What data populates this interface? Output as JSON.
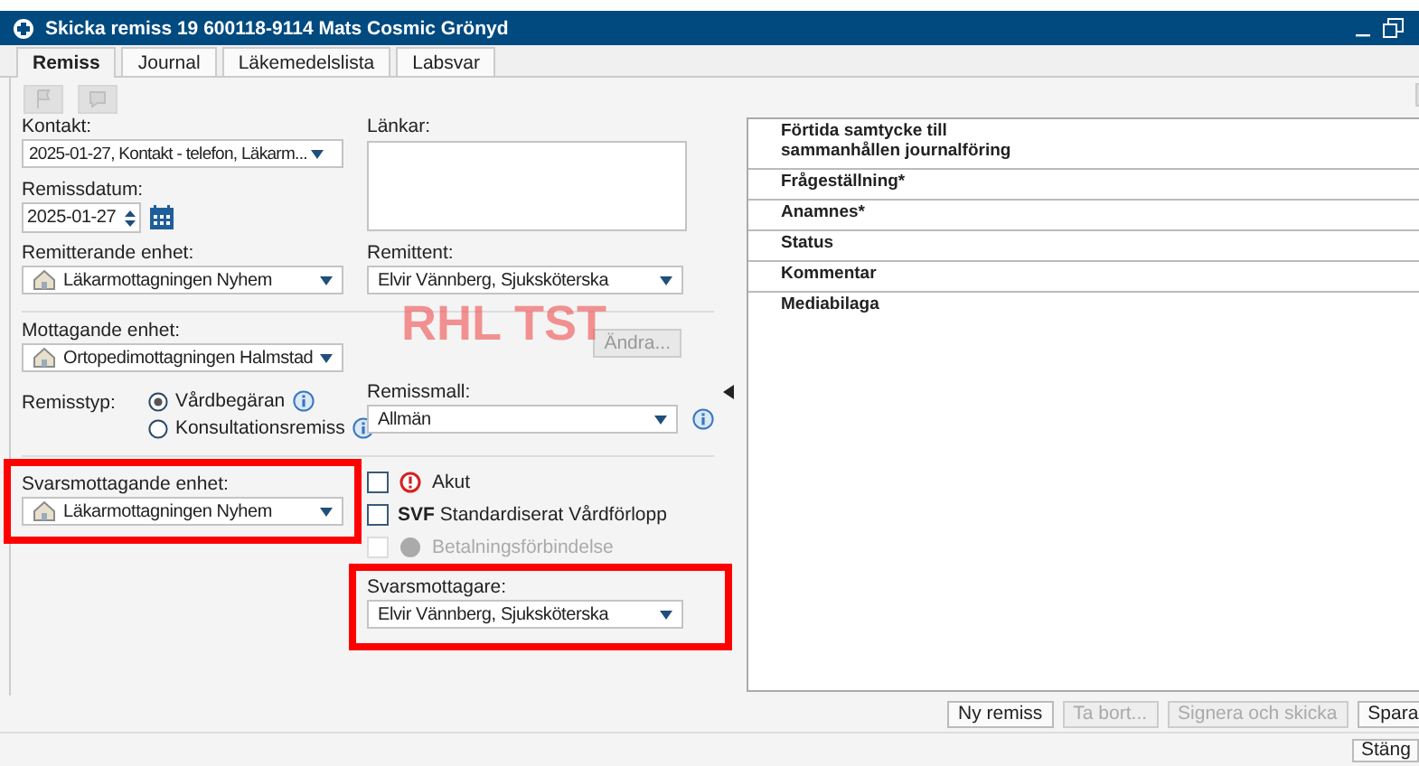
{
  "window": {
    "title": "Skicka remiss 19 600118-9114 Mats Cosmic Grönyd"
  },
  "tabs": [
    {
      "label": "Remiss",
      "selected": true
    },
    {
      "label": "Journal",
      "selected": false
    },
    {
      "label": "Läkemedelslista",
      "selected": false
    },
    {
      "label": "Labsvar",
      "selected": false
    }
  ],
  "toolbar": [
    {
      "kind": "flag",
      "disabled": true
    },
    {
      "kind": "comment",
      "disabled": true
    }
  ],
  "environment_label": "RHL TST",
  "form": {
    "kontakt": {
      "label": "Kontakt:",
      "value": "2025-01-27, Kontakt - telefon, Läkarm..."
    },
    "remissdatum": {
      "label": "Remissdatum:",
      "value": "2025-01-27"
    },
    "lankar": {
      "label": "Länkar:"
    },
    "remitterande_enhet": {
      "label": "Remitterande enhet:",
      "value": "Läkarmottagningen Nyhem"
    },
    "remittent": {
      "label": "Remittent:",
      "value": "Elvir Vännberg, Sjuksköterska"
    },
    "mottagande_enhet": {
      "label": "Mottagande enhet:",
      "value": "Ortopedimottagningen Halmstad"
    },
    "change_button": {
      "label": "Ändra...",
      "disabled": true
    },
    "remisstyp": {
      "label": "Remisstyp:",
      "options": [
        {
          "label": "Vårdbegäran",
          "selected": true
        },
        {
          "label": "Konsultationsremiss",
          "selected": false
        }
      ]
    },
    "remissmall": {
      "label": "Remissmall:",
      "value": "Allmän"
    },
    "svarsmottagande_enhet": {
      "label": "Svarsmottagande enhet:",
      "value": "Läkarmottagningen Nyhem",
      "highlighted": true
    },
    "checkboxes": [
      {
        "kind": "urgent",
        "label": "Akut",
        "checked": false,
        "disabled": false
      },
      {
        "kind": "prefixed",
        "prefix": "SVF",
        "label": "Standardiserat Vårdförlopp",
        "checked": false,
        "disabled": false
      },
      {
        "kind": "payment",
        "label": "Betalningsförbindelse",
        "checked": false,
        "disabled": true
      }
    ],
    "svarsmottagare": {
      "label": "Svarsmottagare:",
      "value": "Elvir Vännberg, Sjuksköterska",
      "highlighted": true
    }
  },
  "sections": [
    {
      "title": "Förtida samtycke till\nsammanhållen journalföring"
    },
    {
      "title": "Frågeställning*"
    },
    {
      "title": "Anamnes*"
    },
    {
      "title": "Status"
    },
    {
      "title": "Kommentar"
    },
    {
      "title": "Mediabilaga"
    }
  ],
  "buttons": [
    {
      "label": "Ny remiss",
      "disabled": false
    },
    {
      "label": "Ta bort...",
      "disabled": true
    },
    {
      "label": "Signera och skicka",
      "disabled": true
    },
    {
      "label": "Spara",
      "disabled": false
    }
  ],
  "close_button": {
    "label": "Stäng"
  }
}
